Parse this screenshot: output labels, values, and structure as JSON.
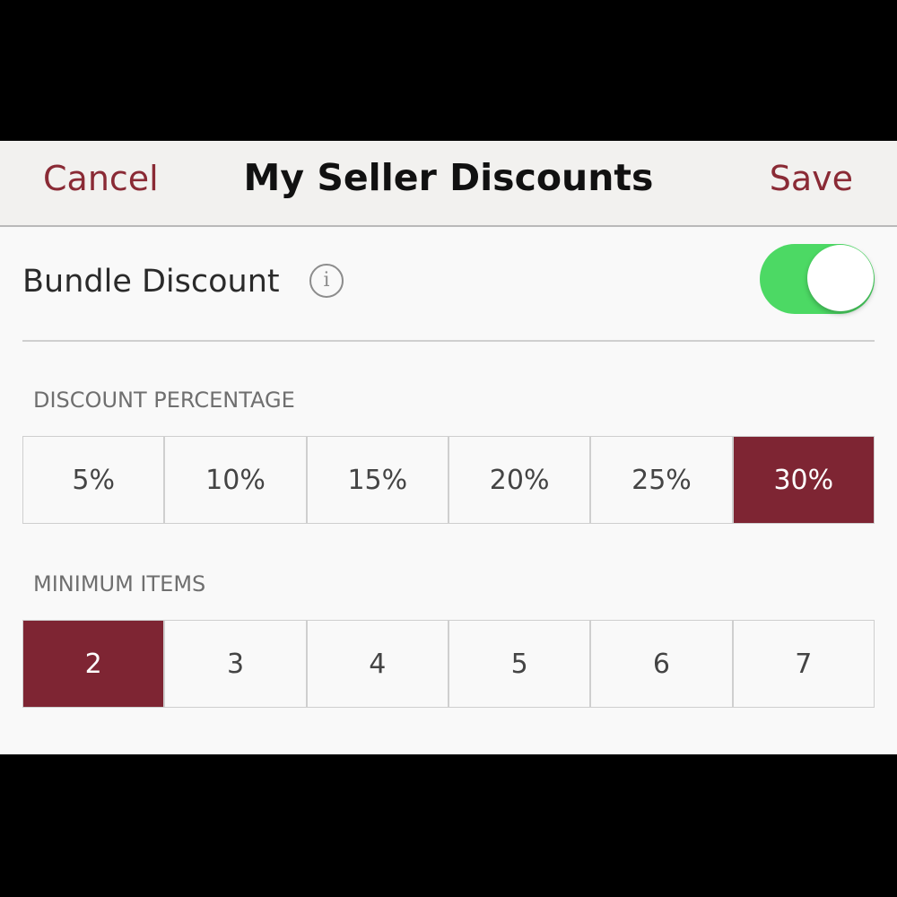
{
  "navbar": {
    "cancel_label": "Cancel",
    "title": "My Seller Discounts",
    "save_label": "Save"
  },
  "bundle": {
    "label": "Bundle Discount",
    "info_icon": "i",
    "enabled": true
  },
  "discount_percentage": {
    "label": "DISCOUNT PERCENTAGE",
    "options": [
      "5%",
      "10%",
      "15%",
      "20%",
      "25%",
      "30%"
    ],
    "selected": "30%"
  },
  "minimum_items": {
    "label": "MINIMUM ITEMS",
    "options": [
      "2",
      "3",
      "4",
      "5",
      "6",
      "7"
    ],
    "selected": "2"
  },
  "colors": {
    "accent": "#8a2a35",
    "selected_segment": "#7e2533",
    "toggle_on": "#4cd964"
  }
}
